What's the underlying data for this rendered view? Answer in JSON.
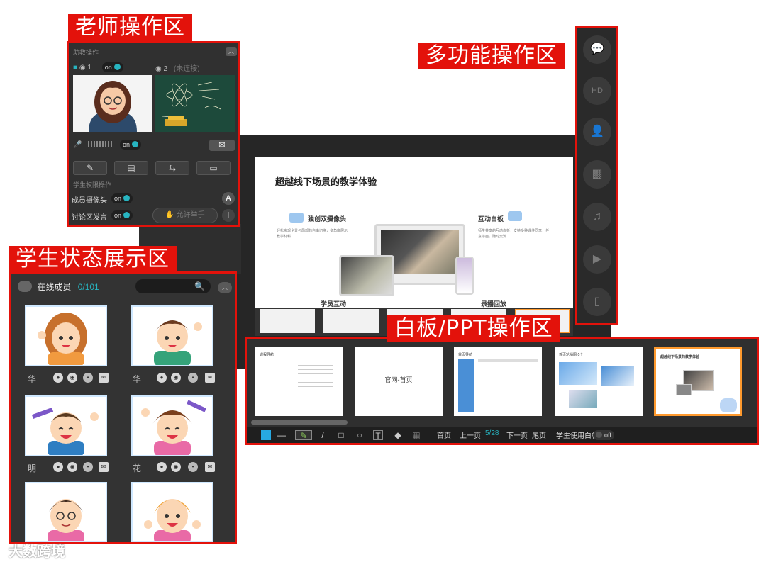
{
  "zones": {
    "teacher": "老师操作区",
    "multi": "多功能操作区",
    "student": "学生状态展示区",
    "board": "白板/PPT操作区"
  },
  "slide": {
    "title": "超越线下场景的教学体验",
    "feature1": "独创双摄像头",
    "feature1_desc": "轻松实现全景与局部的自由切换，多角度展示教学材料",
    "feature2": "互动白板",
    "feature2_desc": "师生共享的互动白板，支持多种课件同享，任意涂画，随时交流",
    "feature3": "学员互动",
    "feature4": "录播回放"
  },
  "teacher_panel": {
    "header": "助教操作",
    "cam1_label": "1",
    "cam1_toggle": "on",
    "cam2_label": "2",
    "cam2_status": "(未连接)",
    "mic_toggle": "on",
    "student_perm_header": "学生权限操作",
    "member_cam_label": "成员摄像头",
    "member_cam_toggle": "on",
    "discuss_label": "讨论区发言",
    "discuss_toggle": "on",
    "raise_hand": "允许举手",
    "round_a": "A"
  },
  "student_panel": {
    "title": "在线成员",
    "count": "0/101",
    "students": [
      {
        "name": "华"
      },
      {
        "name": "华"
      },
      {
        "name": "明"
      },
      {
        "name": "花"
      }
    ]
  },
  "board": {
    "thumbs": [
      {
        "head": "课程导航",
        "center": ""
      },
      {
        "head": "",
        "center": "官网-首页"
      },
      {
        "head": "首页导航",
        "center": ""
      },
      {
        "head": "首页轮播图-5个",
        "center": ""
      },
      {
        "head": "超越线下场景的教学体验",
        "center": ""
      }
    ],
    "toolbar": {
      "first": "首页",
      "prev": "上一页",
      "page": "5/28",
      "next": "下一页",
      "last": "尾页",
      "student_board": "学生使用白板",
      "student_board_toggle": "off"
    }
  },
  "watermark": "大数跨境",
  "colors": {
    "accent": "#27b4c0",
    "zone_red": "#e3120b"
  }
}
